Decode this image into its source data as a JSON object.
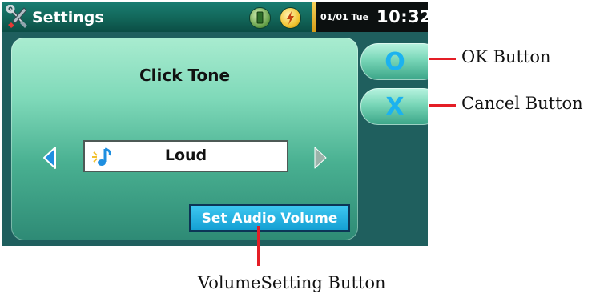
{
  "titlebar": {
    "app_icon": "wrench-screwdriver-icon",
    "title": "Settings",
    "status_icons": [
      "battery-icon",
      "gps-signal-icon"
    ],
    "date": "01/01 Tue",
    "time": "10:32"
  },
  "panel": {
    "title": "Click Tone",
    "value": "Loud",
    "value_icon": "music-note-icon",
    "set_volume_label": "Set Audio Volume"
  },
  "side_buttons": {
    "ok_glyph": "O",
    "cancel_glyph": "X"
  },
  "callouts": {
    "ok": "OK Button",
    "cancel": "Cancel Button",
    "volume": "VolumeSetting Button"
  },
  "colors": {
    "accent_blue": "#1cb2ef",
    "callout_red": "#e41e26",
    "button_blue": "#149fd3"
  }
}
